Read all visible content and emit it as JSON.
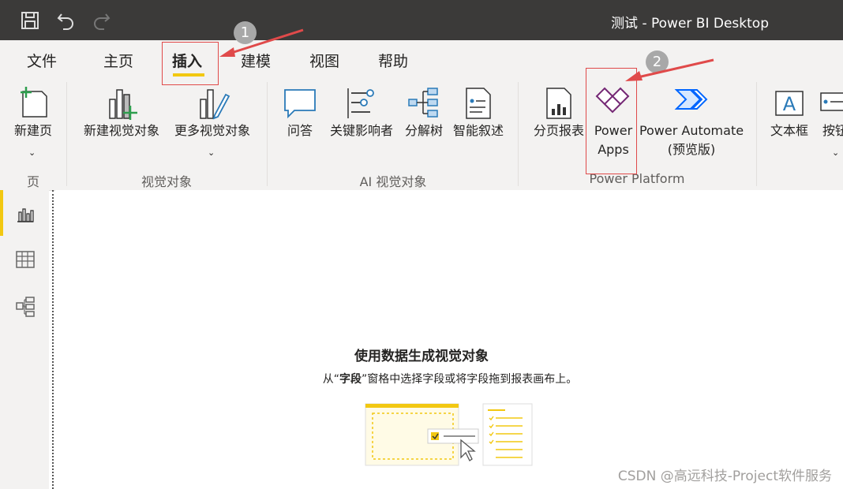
{
  "window": {
    "title": "测试 - Power BI Desktop"
  },
  "quick_access": {
    "save_icon": "save-icon",
    "undo_icon": "undo-icon",
    "redo_icon": "redo-icon"
  },
  "tabs": [
    {
      "label": "文件"
    },
    {
      "label": "主页"
    },
    {
      "label": "插入"
    },
    {
      "label": "建模"
    },
    {
      "label": "视图"
    },
    {
      "label": "帮助"
    }
  ],
  "ribbon": {
    "pages": {
      "new_page": "新建页",
      "group": "页"
    },
    "visuals": {
      "new_visual": "新建视觉对象",
      "more_visuals": "更多视觉对象",
      "group": "视觉对象"
    },
    "ai": {
      "qa": "问答",
      "key_influencers": "关键影响者",
      "decomp_tree": "分解树",
      "smart_narrative": "智能叙述",
      "group": "AI 视觉对象"
    },
    "platform": {
      "paginated": "分页报表",
      "powerapps_line1": "Power",
      "powerapps_line2": "Apps",
      "automate_line1": "Power Automate",
      "automate_line2": "(预览版)",
      "group": "Power Platform"
    },
    "elements": {
      "textbox": "文本框",
      "buttons": "按钮"
    }
  },
  "annotations": {
    "badge1": "1",
    "badge2": "2"
  },
  "canvas": {
    "empty_title": "使用数据生成视觉对象",
    "empty_sub_pre": "从“",
    "empty_sub_bold": "字段",
    "empty_sub_post": "”窗格中选择字段或将字段拖到报表画布上。"
  },
  "watermark": "CSDN @高远科技-Project软件服务",
  "colors": {
    "accent": "#f2c811",
    "titlebar": "#3b3a39",
    "annotation_red": "#e04a4a",
    "powerapps": "#742774",
    "automate": "#0066ff"
  }
}
